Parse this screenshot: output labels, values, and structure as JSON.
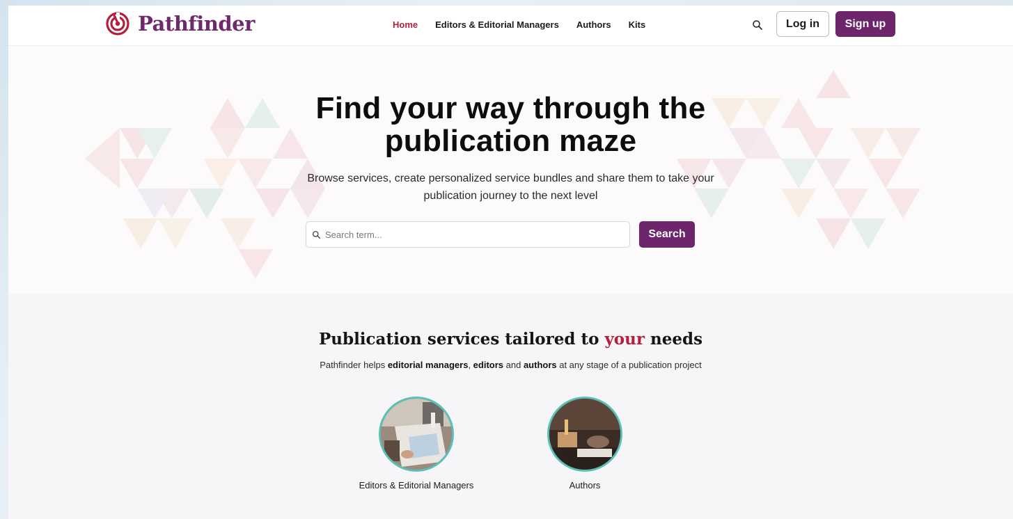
{
  "brand": {
    "name": "Pathfinder",
    "accent": "#b21e3c",
    "primary": "#6d256b"
  },
  "nav": {
    "items": [
      {
        "label": "Home",
        "active": true
      },
      {
        "label": "Editors & Editorial Managers",
        "active": false
      },
      {
        "label": "Authors",
        "active": false
      },
      {
        "label": "Kits",
        "active": false
      }
    ],
    "search_icon": "search-icon",
    "login_label": "Log in",
    "signup_label": "Sign up"
  },
  "hero": {
    "title_line1": "Find your way through the",
    "title_line2": "publication maze",
    "subtitle_line1": "Browse services, create personalized service bundles and share them to take your",
    "subtitle_line2": "publication journey to the next level",
    "search_placeholder": "Search term...",
    "search_button": "Search"
  },
  "services": {
    "title_before": "Publication services tailored to ",
    "title_accent": "your",
    "title_after": " needs",
    "subtitle_parts": [
      {
        "text": "Pathfinder helps ",
        "bold": false
      },
      {
        "text": "editorial managers",
        "bold": true
      },
      {
        "text": ", ",
        "bold": false
      },
      {
        "text": "editors",
        "bold": true
      },
      {
        "text": " and ",
        "bold": false
      },
      {
        "text": "authors",
        "bold": true
      },
      {
        "text": " at any stage of a publication project",
        "bold": false
      }
    ],
    "cards": [
      {
        "label": "Editors & Editorial Managers",
        "image": "editors-photo"
      },
      {
        "label": "Authors",
        "image": "authors-photo"
      }
    ]
  }
}
